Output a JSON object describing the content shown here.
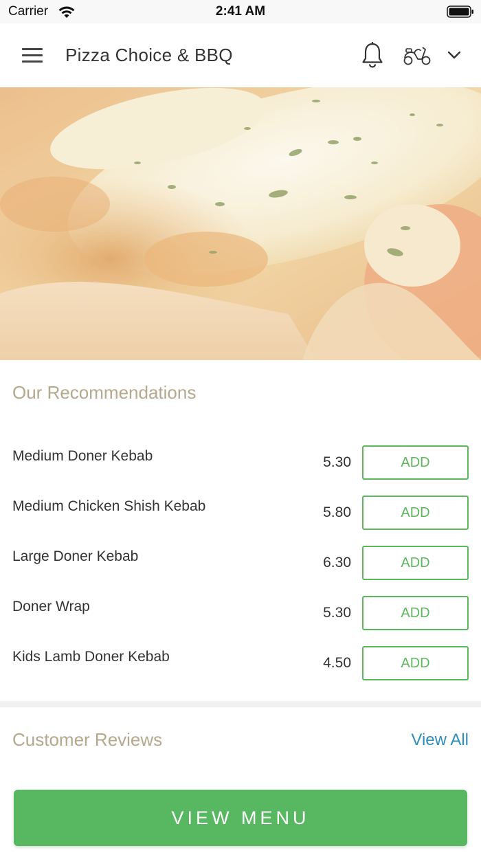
{
  "status_bar": {
    "carrier": "Carrier",
    "time": "2:41 AM"
  },
  "nav": {
    "title": "Pizza Choice & BBQ",
    "icons": [
      "menu-icon",
      "bell-icon",
      "scooter-icon",
      "chevron-down-icon"
    ]
  },
  "hero": {
    "image": "pizza-closeup"
  },
  "recommendations": {
    "title": "Our Recommendations",
    "items": [
      {
        "name": "Medium Doner Kebab",
        "price": "5.30",
        "button": "ADD"
      },
      {
        "name": "Medium Chicken Shish Kebab",
        "price": "5.80",
        "button": "ADD"
      },
      {
        "name": "Large Doner Kebab",
        "price": "6.30",
        "button": "ADD"
      },
      {
        "name": "Doner Wrap",
        "price": "5.30",
        "button": "ADD"
      },
      {
        "name": "Kids Lamb Doner Kebab",
        "price": "4.50",
        "button": "ADD"
      }
    ]
  },
  "reviews": {
    "title": "Customer Reviews",
    "view_all": "View All"
  },
  "cta": {
    "label": "VIEW MENU"
  },
  "colors": {
    "accent_green": "#58b862",
    "section_title": "#b5a88c",
    "link_blue": "#2e8fbe"
  }
}
